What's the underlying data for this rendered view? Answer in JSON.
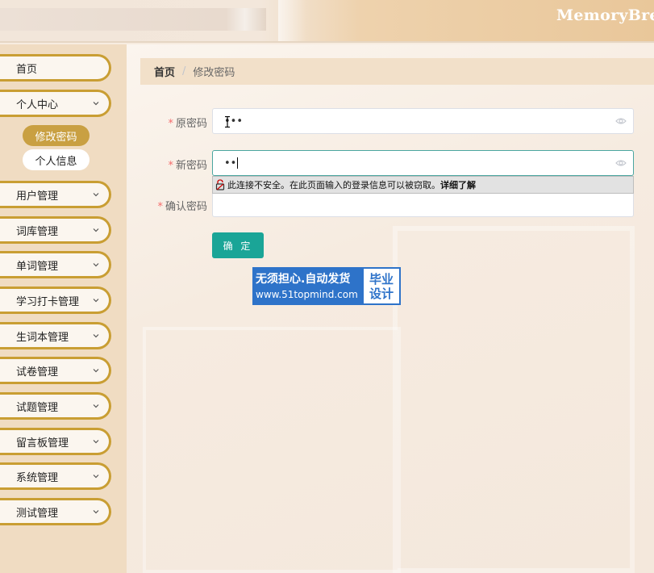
{
  "header": {
    "title": "MemoryBread"
  },
  "sidebar": {
    "items": [
      {
        "label": "首页"
      },
      {
        "label": "个人中心"
      },
      {
        "label": "用户管理"
      },
      {
        "label": "词库管理"
      },
      {
        "label": "单词管理"
      },
      {
        "label": "学习打卡管理"
      },
      {
        "label": "生词本管理"
      },
      {
        "label": "试卷管理"
      },
      {
        "label": "试题管理"
      },
      {
        "label": "留言板管理"
      },
      {
        "label": "系统管理"
      },
      {
        "label": "测试管理"
      }
    ],
    "submenu": [
      {
        "label": "修改密码",
        "active": true
      },
      {
        "label": "个人信息",
        "active": false
      }
    ]
  },
  "breadcrumb": {
    "home": "首页",
    "separator": "/",
    "current": "修改密码"
  },
  "form": {
    "old_password": {
      "label": "原密码",
      "value": "•••"
    },
    "new_password": {
      "label": "新密码",
      "value": "••"
    },
    "confirm_password": {
      "label": "确认密码",
      "value": ""
    },
    "required_mark": "*",
    "submit_label": "确 定"
  },
  "browser_warning": {
    "text": "此连接不安全。在此页面输入的登录信息可以被窃取。",
    "link": "详细了解"
  },
  "watermark": {
    "line1": "无须担心.自动发货",
    "line2": "www.51topmind.com",
    "badge_line1": "毕业",
    "badge_line2": "设计"
  },
  "colors": {
    "accent_gold": "#c99e33",
    "primary_button": "#1aa597",
    "sidebar_bg": "#f0dcc2",
    "watermark_blue": "#2e73c9"
  }
}
